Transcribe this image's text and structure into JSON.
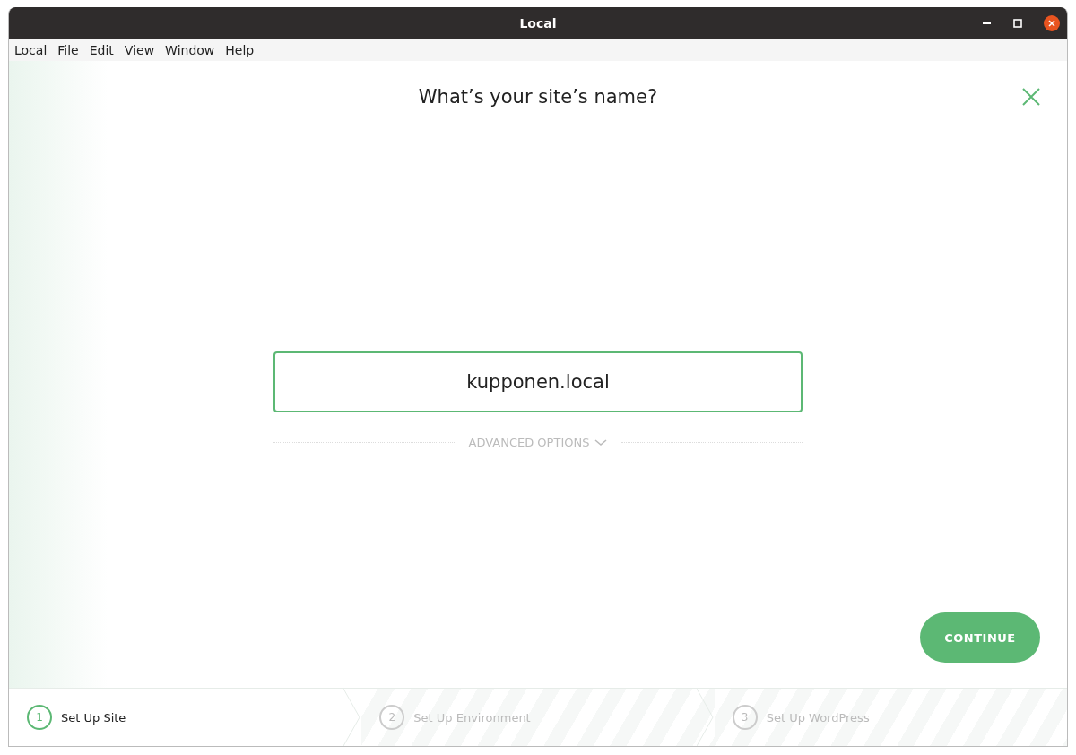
{
  "window": {
    "title": "Local"
  },
  "menu": [
    "Local",
    "File",
    "Edit",
    "View",
    "Window",
    "Help"
  ],
  "heading": "What’s your site’s name?",
  "site_name": {
    "value": "kupponen.local"
  },
  "advanced_options": {
    "label": "ADVANCED OPTIONS",
    "expanded": false
  },
  "continue_button": "CONTINUE",
  "steps": [
    {
      "number": "1",
      "label": "Set Up Site",
      "selected": true
    },
    {
      "number": "2",
      "label": "Set Up Environment",
      "selected": false
    },
    {
      "number": "3",
      "label": "Set Up WordPress",
      "selected": false
    }
  ]
}
